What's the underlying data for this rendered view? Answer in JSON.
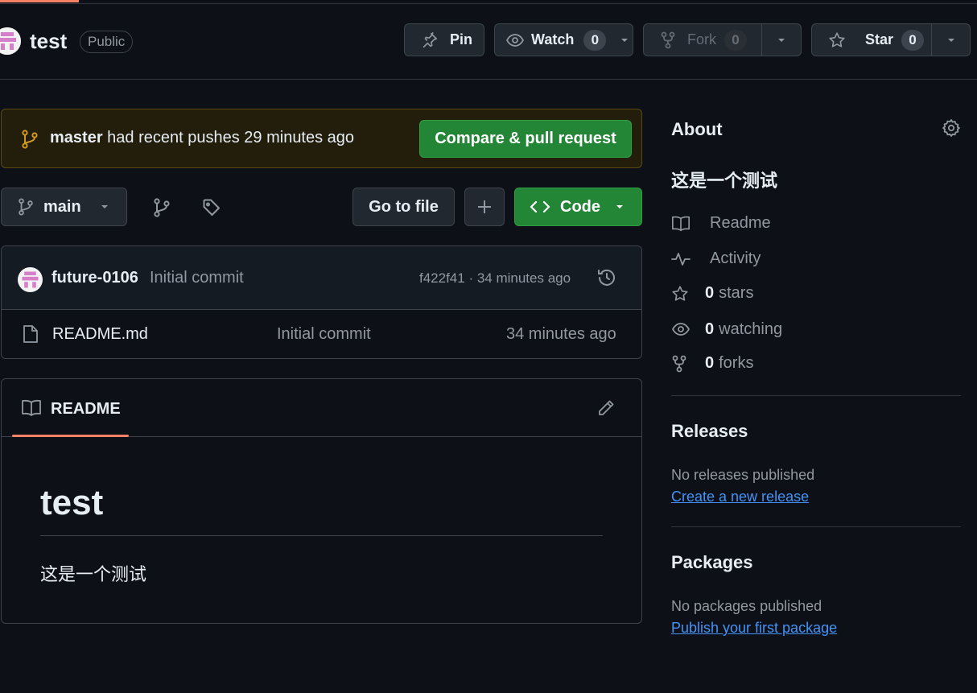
{
  "colors": {
    "bg": "#0d1117",
    "accent": "#f78166",
    "green": "#238636",
    "link": "#4493f8",
    "muted": "#9198a1"
  },
  "header": {
    "repo_name": "test",
    "visibility": "Public",
    "pin_label": "Pin",
    "watch_label": "Watch",
    "watch_count": "0",
    "fork_label": "Fork",
    "fork_count": "0",
    "star_label": "Star",
    "star_count": "0"
  },
  "banner": {
    "branch": "master",
    "message": " had recent pushes 29 minutes ago",
    "button_label": "Compare & pull request"
  },
  "toolbar": {
    "branch_label": "main",
    "go_to_file_label": "Go to file",
    "code_label": "Code"
  },
  "latest_commit": {
    "author": "future-0106",
    "message": "Initial commit",
    "meta": "f422f41 · 34 minutes ago"
  },
  "files": [
    {
      "name": "README.md",
      "commit": "Initial commit",
      "age": "34 minutes ago",
      "icon": "file-icon"
    }
  ],
  "readme": {
    "tab_label": "README",
    "heading": "test",
    "body": "这是一个测试"
  },
  "about": {
    "title": "About",
    "description": "这是一个测试",
    "items": [
      {
        "icon": "book-icon",
        "count": "",
        "label": "Readme"
      },
      {
        "icon": "pulse-icon",
        "count": "",
        "label": "Activity"
      },
      {
        "icon": "star-icon",
        "count": "0",
        "label": "stars"
      },
      {
        "icon": "eye-icon",
        "count": "0",
        "label": "watching"
      },
      {
        "icon": "fork-icon",
        "count": "0",
        "label": "forks"
      }
    ]
  },
  "releases": {
    "title": "Releases",
    "empty_text": "No releases published",
    "link_text": "Create a new release"
  },
  "packages": {
    "title": "Packages",
    "empty_text": "No packages published",
    "link_text": "Publish your first package"
  }
}
